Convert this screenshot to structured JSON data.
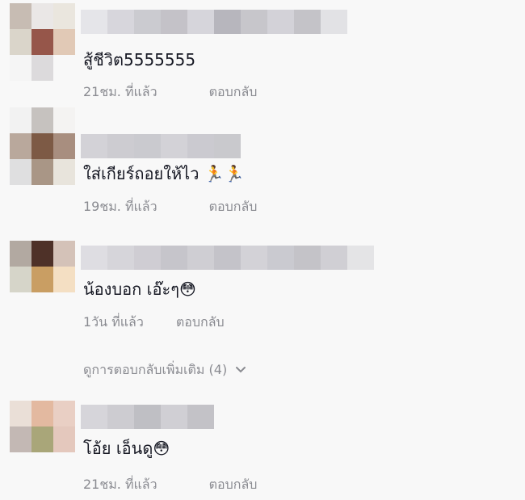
{
  "comments": [
    {
      "text": "สู้ชีวิต5555555",
      "time": "21ชม. ที่แล้ว",
      "reply": "ตอบกลับ",
      "avatar_colors": [
        "#c7bcb3",
        "#eae7e6",
        "#eae6de",
        "#dad5ca",
        "#96564a",
        "#e1c9b6",
        "#f5f5f5",
        "#dcdadc",
        "#f8f8f8"
      ],
      "username_colors": [
        "#e5e5e9",
        "#d7d6dc",
        "#cbcbd0",
        "#c4c2c8",
        "#d6d5db",
        "#b7b6bd",
        "#c7c6cb",
        "#d3d2d8",
        "#c4c3c8",
        "#e2e2e5"
      ]
    },
    {
      "text": "ใส่เกียร์ถอยให้ไว 🏃🏃",
      "time": "19ชม. ที่แล้ว",
      "reply": "ตอบกลับ",
      "avatar_colors": [
        "#f2f2f2",
        "#c6c2bf",
        "#f4f3f2",
        "#b9a89c",
        "#7d5a45",
        "#a88e7f",
        "#dfdfe0",
        "#a99686",
        "#e8e4dc"
      ],
      "username_colors": [
        "#d3d2d7",
        "#cdccd1",
        "#cacacf",
        "#d3d2d7",
        "#cbcad0",
        "#c9c9cd"
      ]
    },
    {
      "text": "น้องบอก เอ๊ะๆ😳",
      "time": "1วัน ที่แล้ว",
      "reply": "ตอบกลับ",
      "avatar_colors": [
        "#b2a9a1",
        "#4e3128",
        "#d4c2b8",
        "#d6d5c9",
        "#c99e63",
        "#f4dfc3",
        "#f8f8f8",
        "#f8f8f8",
        "#f8f8f8"
      ],
      "username_colors": [
        "#dedde2",
        "#d6d5da",
        "#cfcdd3",
        "#c6c5cb",
        "#cfced3",
        "#c4c3c9",
        "#d3d2d7",
        "#cacad0",
        "#c4c3c8",
        "#d0cfd4",
        "#e4e4e6"
      ]
    },
    {
      "text": "โอ้ย เอ็นดู😳",
      "time": "21ชม. ที่แล้ว",
      "reply": "ตอบกลับ",
      "avatar_colors": [
        "#eadfd7",
        "#e3b9a0",
        "#e9cfc4",
        "#c3b8b4",
        "#a9a679",
        "#e4c8bd",
        "#f8f8f8",
        "#f8f8f8",
        "#f8f8f8"
      ],
      "username_colors": [
        "#d6d5da",
        "#cdccd1",
        "#bfbfc4",
        "#d0cfd4",
        "#c3c2c7"
      ]
    }
  ],
  "view_more": {
    "label": "ดูการตอบกลับเพิ่มเติม (4)"
  }
}
